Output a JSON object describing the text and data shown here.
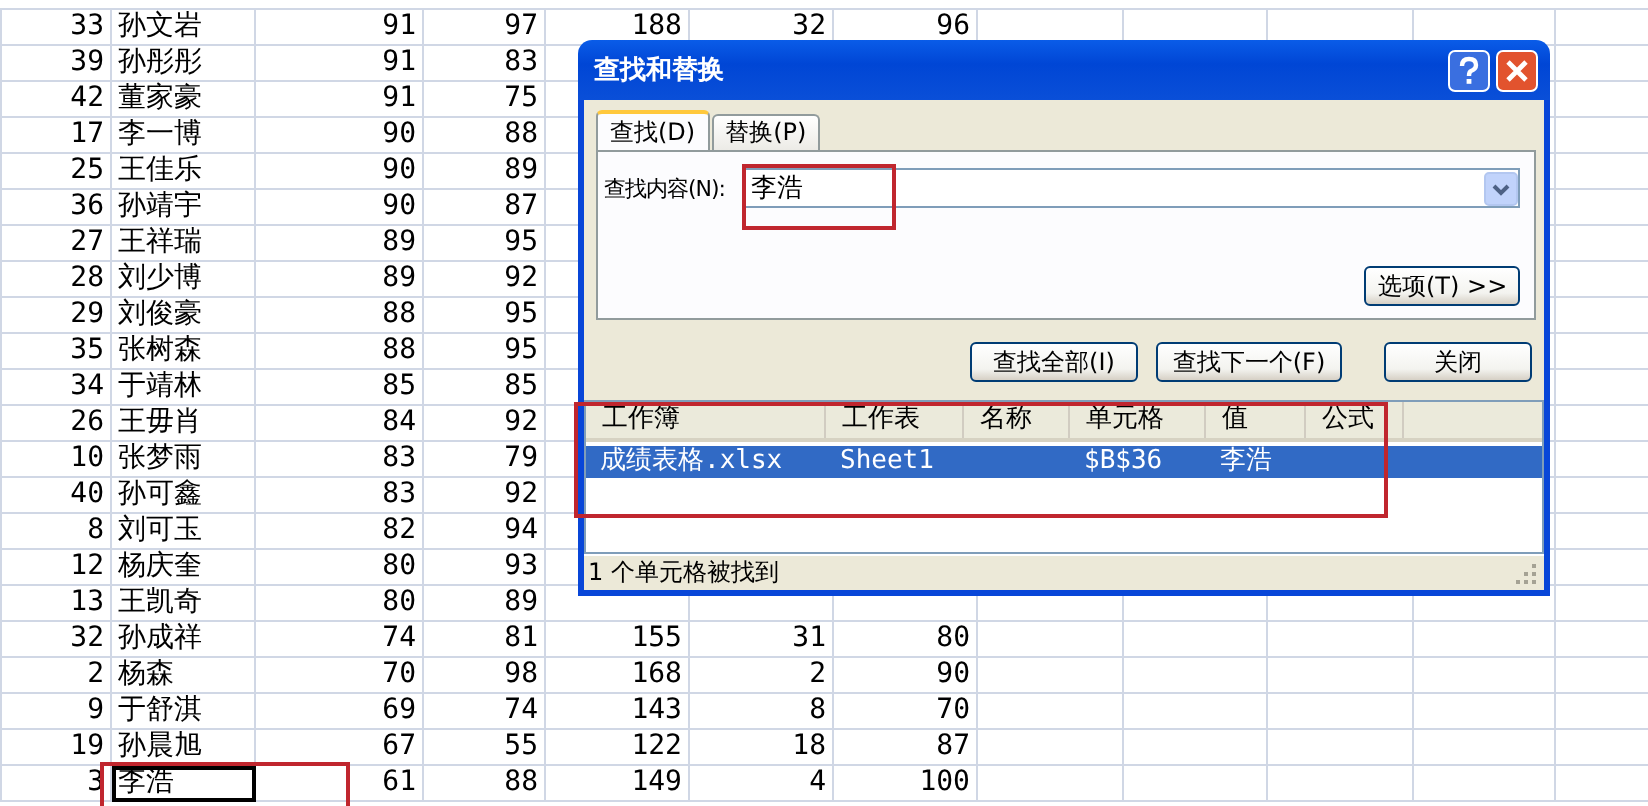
{
  "sheet": {
    "rows": [
      {
        "cells": [
          "33",
          "孙文岩",
          "91",
          "97",
          "188",
          "32",
          "96"
        ],
        "selected": false
      },
      {
        "cells": [
          "39",
          "孙彤彤",
          "91",
          "83"
        ],
        "selected": false
      },
      {
        "cells": [
          "42",
          "董家豪",
          "91",
          "75"
        ],
        "selected": false
      },
      {
        "cells": [
          "17",
          "李一博",
          "90",
          "88"
        ],
        "selected": false
      },
      {
        "cells": [
          "25",
          "王佳乐",
          "90",
          "89"
        ],
        "selected": false
      },
      {
        "cells": [
          "36",
          "孙靖宇",
          "90",
          "87"
        ],
        "selected": false
      },
      {
        "cells": [
          "27",
          "王祥瑞",
          "89",
          "95"
        ],
        "selected": false
      },
      {
        "cells": [
          "28",
          "刘少博",
          "89",
          "92"
        ],
        "selected": false
      },
      {
        "cells": [
          "29",
          "刘俊豪",
          "88",
          "95"
        ],
        "selected": false
      },
      {
        "cells": [
          "35",
          "张树森",
          "88",
          "95"
        ],
        "selected": false
      },
      {
        "cells": [
          "34",
          "于靖林",
          "85",
          "85"
        ],
        "selected": false
      },
      {
        "cells": [
          "26",
          "王毋肖",
          "84",
          "92"
        ],
        "selected": false
      },
      {
        "cells": [
          "10",
          "张梦雨",
          "83",
          "79"
        ],
        "selected": false
      },
      {
        "cells": [
          "40",
          "孙可鑫",
          "83",
          "92"
        ],
        "selected": false
      },
      {
        "cells": [
          "8",
          "刘可玉",
          "82",
          "94"
        ],
        "selected": false
      },
      {
        "cells": [
          "12",
          "杨庆奎",
          "80",
          "93"
        ],
        "selected": false
      },
      {
        "cells": [
          "13",
          "王凯奇",
          "80",
          "89"
        ],
        "selected": false
      },
      {
        "cells": [
          "32",
          "孙成祥",
          "74",
          "81",
          "155",
          "31",
          "80"
        ],
        "selected": false
      },
      {
        "cells": [
          "2",
          "杨森",
          "70",
          "98",
          "168",
          "2",
          "90"
        ],
        "selected": false
      },
      {
        "cells": [
          "9",
          "于舒淇",
          "69",
          "74",
          "143",
          "8",
          "70"
        ],
        "selected": false
      },
      {
        "cells": [
          "19",
          "孙晨旭",
          "67",
          "55",
          "122",
          "18",
          "87"
        ],
        "selected": false
      },
      {
        "cells": [
          "3",
          "李浩",
          "61",
          "88",
          "149",
          "4",
          "100"
        ],
        "selected": true
      }
    ]
  },
  "dialog": {
    "title": "查找和替换",
    "tabs": [
      {
        "label": "查找(D)",
        "selected": true
      },
      {
        "label": "替换(P)",
        "selected": false
      }
    ],
    "find_label": "查找内容(N):",
    "find_value": "李浩",
    "options_button": "选项(T) >>",
    "buttons": [
      "查找全部(I)",
      "查找下一个(F)",
      "关闭"
    ],
    "results": {
      "columns": [
        "工作簿",
        "工作表",
        "名称",
        "单元格",
        "值",
        "公式"
      ],
      "rows": [
        {
          "workbook": "成绩表格.xlsx",
          "sheet": "Sheet1",
          "cell": "$B$36",
          "value": "李浩",
          "selected": true
        }
      ]
    },
    "status": "1 个单元格被找到"
  }
}
